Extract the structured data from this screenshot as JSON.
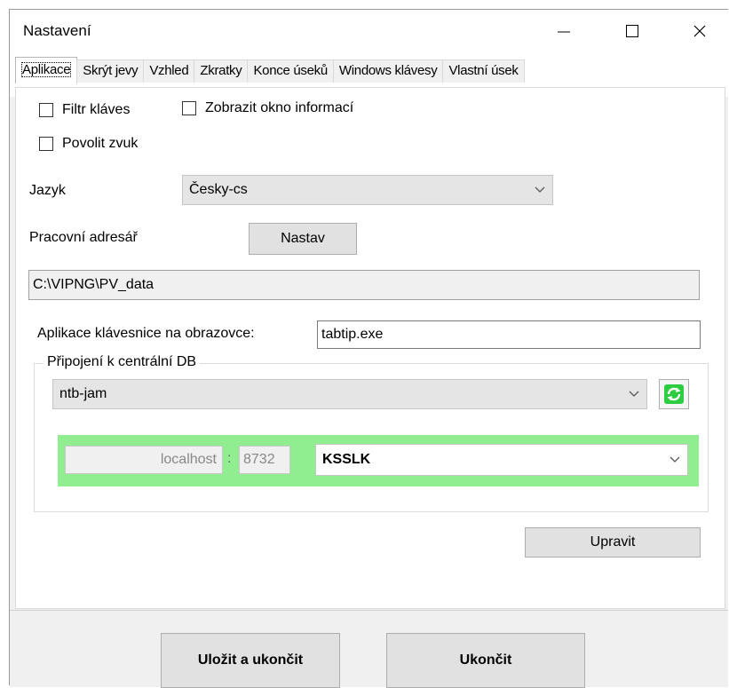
{
  "window": {
    "title": "Nastavení",
    "controls": {
      "minimize": "—",
      "close": "✕"
    }
  },
  "tabs": [
    {
      "label": "Aplikace",
      "active": true
    },
    {
      "label": "Skrýt jevy",
      "active": false
    },
    {
      "label": "Vzhled",
      "active": false
    },
    {
      "label": "Zkratky",
      "active": false
    },
    {
      "label": "Konce úseků",
      "active": false
    },
    {
      "label": "Windows klávesy",
      "active": false
    },
    {
      "label": "Vlastní úsek",
      "active": false
    }
  ],
  "checkboxes": {
    "filtr": {
      "label": "Filtr kláves",
      "checked": false
    },
    "zobrazit": {
      "label": "Zobrazit okno informací",
      "checked": false
    },
    "zvuk": {
      "label": "Povolit zvuk",
      "checked": false
    }
  },
  "language": {
    "label": "Jazyk",
    "value": "Česky-cs"
  },
  "workdir": {
    "label": "Pracovní adresář",
    "button": "Nastav",
    "value": "C:\\VIPNG\\PV_data"
  },
  "keyboard": {
    "label": "Aplikace klávesnice na obrazovce:",
    "value": "tabtip.exe"
  },
  "db": {
    "group_title": "Připojení k centrální DB",
    "connection": "ntb-jam",
    "host": "localhost",
    "separator": ":",
    "port": "8732",
    "database": "KSSLK",
    "panel_color": "#90ee90"
  },
  "buttons": {
    "upravit": "Upravit",
    "save_exit": "Uložit a ukončit",
    "exit": "Ukončit"
  },
  "colors": {
    "refresh_green": "#2ecc40"
  }
}
